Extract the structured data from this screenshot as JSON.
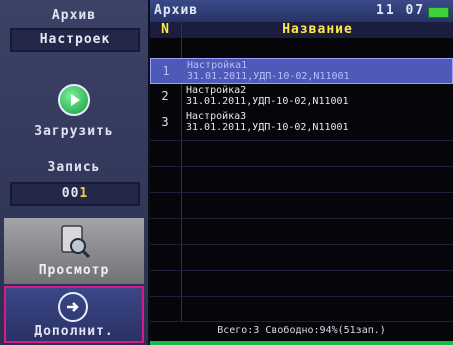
{
  "sidebar": {
    "archive_label": "Архив",
    "settings_field": "Настроек",
    "load_button": "Загрузить",
    "record_label": "Запись",
    "record_value_prefix": "00",
    "record_value_last": "1",
    "view_button": "Просмотр",
    "extra_button": "Дополнит."
  },
  "header": {
    "title": "Архив",
    "time": "11 07"
  },
  "table": {
    "columns": [
      "N",
      "Название"
    ],
    "rows": [
      {
        "n": "1",
        "name": "Настройка1",
        "detail": "31.01.2011,УДП-10-02,N11001",
        "selected": true
      },
      {
        "n": "2",
        "name": "Настройка2",
        "detail": "31.01.2011,УДП-10-02,N11001",
        "selected": false
      },
      {
        "n": "3",
        "name": "Настройка3",
        "detail": "31.01.2011,УДП-10-02,N11001",
        "selected": false
      }
    ]
  },
  "status": "Всего:3 Свободно:94%(51зап.)",
  "icons": {
    "load": "play-icon",
    "view": "document-search-icon",
    "extra": "arrow-right-icon",
    "battery": "battery-icon"
  },
  "colors": {
    "accent_yellow": "#ffe84a",
    "selection": "#4e59b8",
    "status_green": "#19b84a",
    "highlight_border": "#d81a8c"
  }
}
